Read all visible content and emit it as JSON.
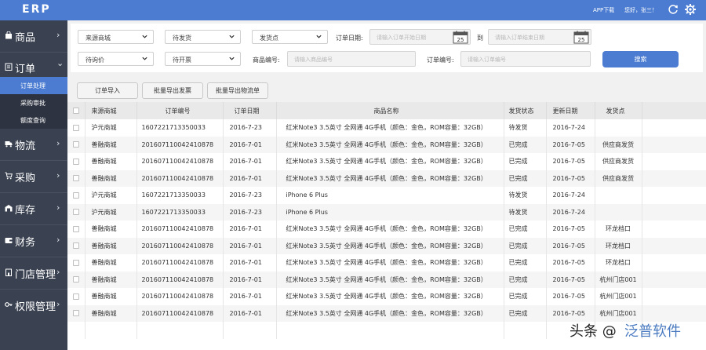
{
  "header": {
    "logo": "ERP",
    "app_download": "APP下载",
    "greeting": "您好，张三！"
  },
  "sidebar": {
    "items": [
      {
        "label": "商品",
        "icon": "bag-icon",
        "arrow": "›"
      },
      {
        "label": "订单",
        "icon": "list-icon",
        "arrow": "⌄"
      },
      {
        "label": "物流",
        "icon": "truck-icon",
        "arrow": "›"
      },
      {
        "label": "采购",
        "icon": "cart-icon",
        "arrow": "›"
      },
      {
        "label": "库存",
        "icon": "warehouse-icon",
        "arrow": "›"
      },
      {
        "label": "财务",
        "icon": "wallet-icon",
        "arrow": "›"
      },
      {
        "label": "门店管理",
        "icon": "store-icon",
        "arrow": "›"
      },
      {
        "label": "权限管理",
        "icon": "key-icon",
        "arrow": "›"
      }
    ],
    "order_sub": [
      {
        "label": "订单处理",
        "active": true
      },
      {
        "label": "采购审批",
        "active": false
      },
      {
        "label": "额度查询",
        "active": false
      }
    ]
  },
  "filters": {
    "source_store": "来源商城",
    "ship_status": "待发货",
    "ship_point": "发货点",
    "price_status": "待询价",
    "invoice_status": "待开票",
    "order_date_label": "订单日期:",
    "start_date_placeholder": "请输入订单开始日期",
    "to_label": "到",
    "end_date_placeholder": "请输入订单结束日期",
    "product_code_label": "商品编号:",
    "product_code_placeholder": "请输入商品编号",
    "order_no_label": "订单编号:",
    "order_no_placeholder": "请输入订单编号",
    "calendar_day": "25",
    "search_button": "搜索"
  },
  "actions": {
    "import_orders": "订单导入",
    "export_invoices": "批量导出发票",
    "export_logistics": "批量导出物流单"
  },
  "table": {
    "columns": [
      "来源商城",
      "订单编号",
      "订单日期",
      "商品名称",
      "发货状态",
      "更新日期",
      "发货点"
    ],
    "rows": [
      [
        "沪元商城",
        "1607221713350033",
        "2016-7-23",
        "红米Note3 3.5英寸 全网通 4G手机（颜色：金色，ROM容量：32GB）",
        "待发货",
        "2016-7-24",
        ""
      ],
      [
        "善融商城",
        "201607110042410878",
        "2016-7-01",
        "红米Note3 3.5英寸 全网通 4G手机（颜色：金色，ROM容量：32GB）",
        "已完成",
        "2016-7-05",
        "供应商发货"
      ],
      [
        "善融商城",
        "201607110042410878",
        "2016-7-01",
        "红米Note3 3.5英寸 全网通 4G手机（颜色：金色，ROM容量：32GB）",
        "已完成",
        "2016-7-05",
        "供应商发货"
      ],
      [
        "善融商城",
        "201607110042410878",
        "2016-7-01",
        "红米Note3 3.5英寸 全网通 4G手机（颜色：金色，ROM容量：32GB）",
        "已完成",
        "2016-7-05",
        "供应商发货"
      ],
      [
        "沪元商城",
        "1607221713350033",
        "2016-7-23",
        "iPhone 6 Plus",
        "待发货",
        "2016-7-24",
        ""
      ],
      [
        "沪元商城",
        "1607221713350033",
        "2016-7-23",
        "iPhone 6 Plus",
        "待发货",
        "2016-7-24",
        ""
      ],
      [
        "善融商城",
        "201607110042410878",
        "2016-7-01",
        "红米Note3 3.5英寸 全网通 4G手机（颜色：金色，ROM容量：32GB）",
        "已完成",
        "2016-7-05",
        "环龙档口"
      ],
      [
        "善融商城",
        "201607110042410878",
        "2016-7-01",
        "红米Note3 3.5英寸 全网通 4G手机（颜色：金色，ROM容量：32GB）",
        "已完成",
        "2016-7-05",
        "环龙档口"
      ],
      [
        "善融商城",
        "201607110042410878",
        "2016-7-01",
        "红米Note3 3.5英寸 全网通 4G手机（颜色：金色，ROM容量：32GB）",
        "已完成",
        "2016-7-05",
        "环龙档口"
      ],
      [
        "善融商城",
        "201607110042410878",
        "2016-7-01",
        "红米Note3 3.5英寸 全网通 4G手机（颜色：金色，ROM容量：32GB）",
        "已完成",
        "2016-7-05",
        "杭州门店001"
      ],
      [
        "善融商城",
        "201607110042410878",
        "2016-7-01",
        "红米Note3 3.5英寸 全网通 4G手机（颜色：金色，ROM容量：32GB）",
        "已完成",
        "2016-7-05",
        "杭州门店001"
      ],
      [
        "善融商城",
        "201607110042410878",
        "2016-7-01",
        "红米Note3 3.5英寸 全网通 4G手机（颜色：金色，ROM容量：32GB）",
        "已完成",
        "2016-7-05",
        "杭州门店001"
      ]
    ]
  },
  "watermark": {
    "text_a": "头条 @",
    "text_b": "泛普软件"
  },
  "colors": {
    "accent": "#4b7cd1",
    "sidebar_bg": "#3a4150",
    "sidebar_sub_bg": "#2d3340"
  }
}
